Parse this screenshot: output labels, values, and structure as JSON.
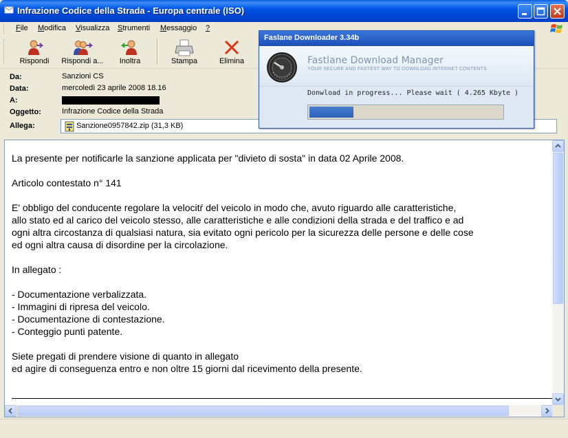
{
  "window": {
    "title": "Infrazione Codice della Strada - Europa centrale (ISO)"
  },
  "menu": [
    "File",
    "Modifica",
    "Visualizza",
    "Strumenti",
    "Messaggio",
    "?"
  ],
  "toolbar": {
    "reply": "Rispondi",
    "reply_all": "Rispondi a...",
    "forward": "Inoltra",
    "print": "Stampa",
    "delete": "Elimina"
  },
  "header": {
    "from_label": "Da:",
    "from": "Sanzioni CS",
    "date_label": "Data:",
    "date": "mercoledì 23 aprile 2008 18.16",
    "to_label": "A:",
    "subject_label": "Oggetto:",
    "subject": "Infrazione Codice della Strada",
    "attach_label": "Allega:",
    "attachment": "Sanzione0957842.zip (31,3 KB)"
  },
  "body": {
    "lines": [
      "La presente per notificarle la sanzione applicata per \"divieto di sosta\" in data 02 Aprile 2008.",
      "",
      "Articolo contestato n° 141",
      "",
      "E' obbligo del conducente regolare la velocitŕ del veicolo in modo che, avuto riguardo alle caratteristiche,",
      "allo stato ed al carico del veicolo stesso, alle caratteristiche e alle condizioni della strada e del traffico e ad",
      "ogni altra circostanza di qualsiasi natura, sia evitato ogni pericolo per la sicurezza delle persone e delle cose",
      "ed ogni altra causa di disordine per la circolazione.",
      "",
      "In allegato :",
      "",
      "- Documentazione verbalizzata.",
      "- Immagini di ripresa del veicolo.",
      "- Documentazione di contestazione.",
      "- Conteggio punti patente.",
      "",
      "Siete pregati di prendere visione di quanto in allegato",
      "ed agire di conseguenza entro e non oltre 15 giorni dal ricevimento della presente."
    ]
  },
  "popup": {
    "title": "Faslane Downloader 3.34b",
    "brand": "Fastlane Download Manager",
    "tagline": "YOUR SECURE AND FASTEST WAY TO DOWNLOAD INTERNET CONTENTS",
    "status": "Donwload in progress... Please wait ( 4.265 Kbyte )",
    "progress_fraction": 0.23
  }
}
